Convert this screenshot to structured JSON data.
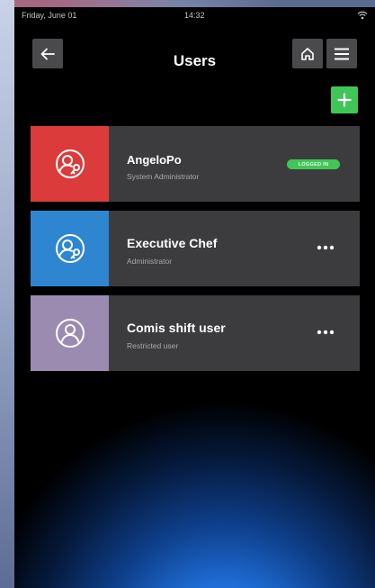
{
  "status_bar": {
    "date": "Friday, June 01",
    "time": "14:32",
    "wifi_icon": "wifi-icon"
  },
  "header": {
    "title": "Users",
    "back_icon": "arrow-left-icon",
    "home_icon": "home-icon",
    "menu_icon": "hamburger-menu-icon"
  },
  "add_button": {
    "icon": "plus-icon",
    "color": "#3fc657"
  },
  "users": [
    {
      "name": "AngeloPo",
      "role": "System Administrator",
      "tile_color": "#db3b3b",
      "icon": "user-key-icon",
      "badge": "LOGGED IN"
    },
    {
      "name": "Executive Chef",
      "role": "Administrator",
      "tile_color": "#2e86d1",
      "icon": "user-key-icon",
      "more_icon": "more-horizontal-icon"
    },
    {
      "name": "Comis shift user",
      "role": "Restricted user",
      "tile_color": "#9b8bb0",
      "icon": "user-icon",
      "more_icon": "more-horizontal-icon"
    }
  ],
  "colors": {
    "card_bg": "#3c3c3e",
    "button_bg": "#4a4a4d",
    "accent_green": "#3fc657"
  }
}
